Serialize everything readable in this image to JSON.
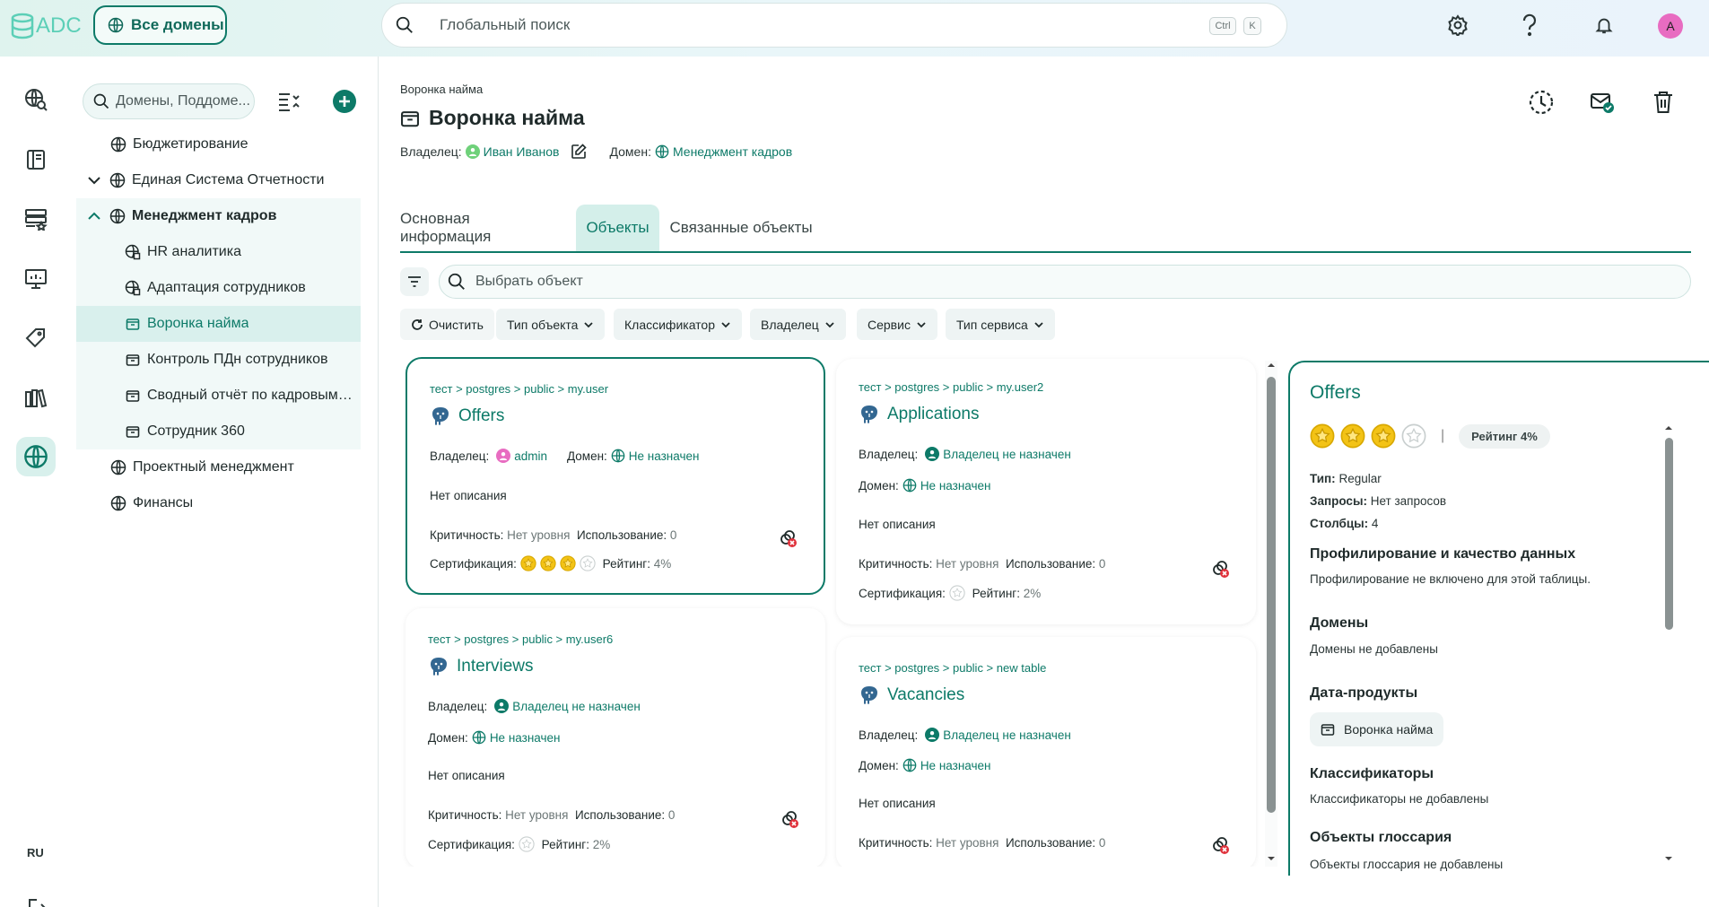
{
  "app": {
    "logo_text": "ADC"
  },
  "header": {
    "domains_button": "Все домены",
    "search_placeholder": "Глобальный поиск",
    "kbd_1": "Ctrl",
    "kbd_2": "K",
    "avatar_letter": "A",
    "avatar_color": "#e86cc1"
  },
  "rail": {
    "language": "RU"
  },
  "tree": {
    "search_placeholder": "Домены, Поддоме...",
    "items": [
      {
        "label": "Бюджетирование"
      },
      {
        "label": "Единая Система Отчетности"
      },
      {
        "label": "Менеджмент кадров"
      },
      {
        "label": "HR аналитика"
      },
      {
        "label": "Адаптация сотрудников"
      },
      {
        "label": "Воронка найма"
      },
      {
        "label": "Контроль ПДн сотрудников"
      },
      {
        "label": "Сводный отчёт по кадровым ..."
      },
      {
        "label": "Сотрудник 360"
      },
      {
        "label": "Проектный менеджмент"
      },
      {
        "label": "Финансы"
      }
    ]
  },
  "page": {
    "breadcrumb": "Воронка найма",
    "title": "Воронка найма",
    "owner_label": "Владелец:",
    "owner_name": "Иван Иванов",
    "domain_label": "Домен:",
    "domain_name": "Менеджмент кадров"
  },
  "tabs": [
    {
      "label": "Основная информация"
    },
    {
      "label": "Объекты"
    },
    {
      "label": "Связанные объекты"
    }
  ],
  "filters": {
    "search_placeholder": "Выбрать объект",
    "clear": "Очистить",
    "chips": [
      "Тип объекта",
      "Классификатор",
      "Владелец",
      "Сервис",
      "Тип сервиса"
    ]
  },
  "labels": {
    "owner": "Владелец:",
    "domain": "Домен:",
    "no_description": "Нет описания",
    "criticality": "Критичность:",
    "usage": "Использование:",
    "certification": "Сертификация:",
    "rating": "Рейтинг:"
  },
  "cards": [
    {
      "path": "тест > postgres > public > my.user",
      "name": "Offers",
      "owner": "admin",
      "domain": "Не назначен",
      "criticality": "Нет уровня",
      "usage": "0",
      "rating": "4%",
      "stars": 3
    },
    {
      "path": "тест > postgres > public > my.user2",
      "name": "Applications",
      "owner": "Владелец не назначен",
      "domain": "Не назначен",
      "criticality": "Нет уровня",
      "usage": "0",
      "rating": "2%",
      "stars": 0
    },
    {
      "path": "тест > postgres > public > my.user6",
      "name": "Interviews",
      "owner": "Владелец не назначен",
      "domain": "Не назначен",
      "criticality": "Нет уровня",
      "usage": "0",
      "rating": "2%",
      "stars": 0
    },
    {
      "path": "тест > postgres > public > new table",
      "name": "Vacancies",
      "owner": "Владелец не назначен",
      "domain": "Не назначен",
      "criticality": "Нет уровня",
      "usage": "0",
      "rating": "",
      "stars": 0
    }
  ],
  "detail": {
    "title": "Offers",
    "stars": 3,
    "rating_pill": "Рейтинг 4%",
    "type_label": "Тип:",
    "type_value": "Regular",
    "queries_label": "Запросы:",
    "queries_value": "Нет запросов",
    "columns_label": "Столбцы:",
    "columns_value": "4",
    "profiling_heading": "Профилирование и качество данных",
    "profiling_text": "Профилирование не включено для этой таблицы.",
    "domains_heading": "Домены",
    "domains_text": "Домены не добавлены",
    "dataproducts_heading": "Дата-продукты",
    "dataproduct_chip": "Воронка найма",
    "classifiers_heading": "Классификаторы",
    "classifiers_text": "Классификаторы не добавлены",
    "glossary_heading": "Объекты глоссария",
    "glossary_text": "Объекты глоссария не добавлены"
  },
  "colors": {
    "accent": "#0d7a68",
    "accent_light": "#d4efea",
    "star": "#f3c316"
  }
}
